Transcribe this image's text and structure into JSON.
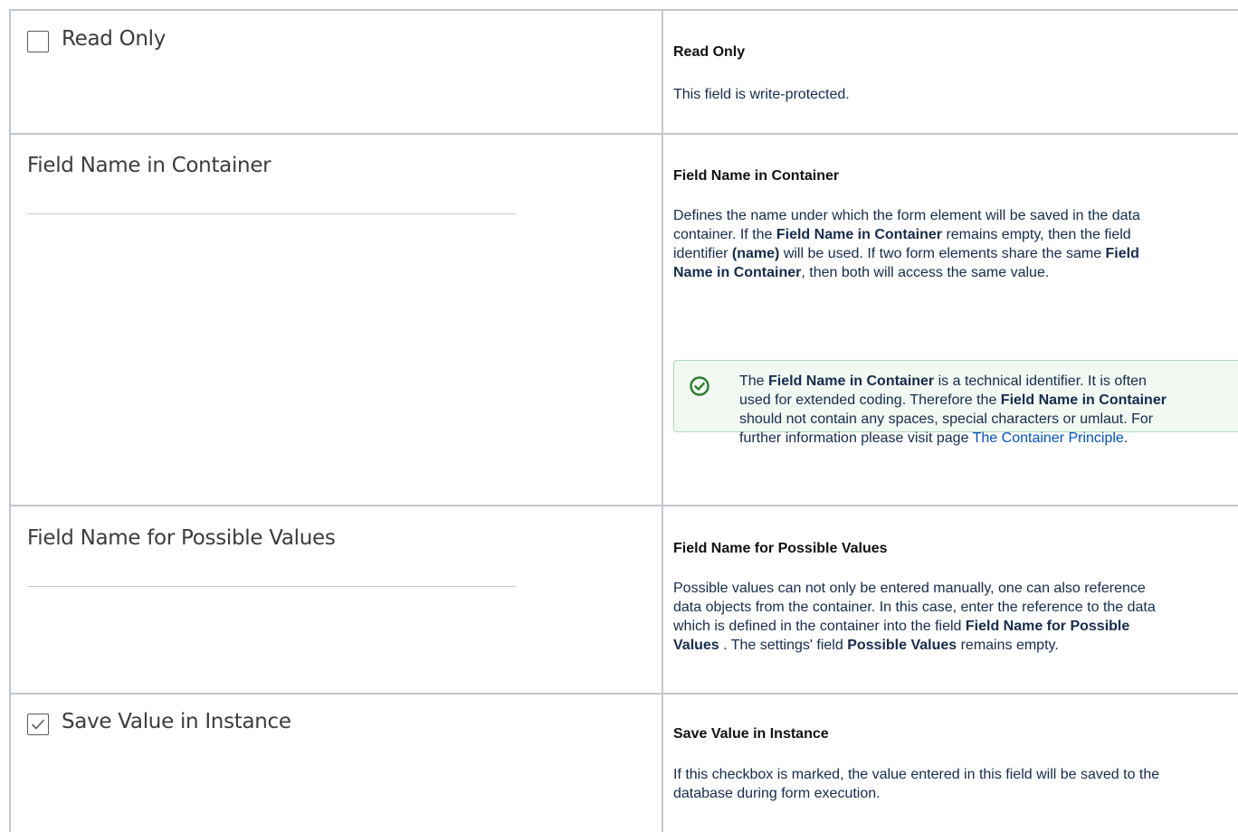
{
  "rows": [
    {
      "left_label": "Read Only",
      "left_checked": false,
      "heading": "Read Only",
      "text": "This field is write-protected."
    },
    {
      "left_label": "Field Name in Container",
      "heading": "Field Name in Container",
      "para": {
        "t1": "Defines the name under which the form element will be saved in the data",
        "t2": "container. If the ",
        "b1": "Field Name in Container",
        "t3": " remains empty, then the field",
        "t4": "identifier ",
        "b2": "(name)",
        "t5": " will be used. If two form elements share the same ",
        "b3": "Field",
        "b4": "Name in Container",
        "t6": ", then both will access the same value."
      },
      "note": {
        "icon": "check-circle-icon",
        "t1": "The ",
        "b1": "Field Name in Container",
        "t2": " is a technical identifier. It is often",
        "t3": "used for extended coding. Therefore the ",
        "b2": "Field Name in Container",
        "t4": "should not contain any spaces, special characters or umlaut. For",
        "t5": "further information please visit page ",
        "link": "The Container Principle",
        "t6": "."
      }
    },
    {
      "left_label": "Field Name for Possible Values",
      "heading": "Field Name for Possible Values",
      "para": {
        "t1": "Possible values can not only be entered manually, one can also reference",
        "t2": "data objects from the container. In this case, enter the reference to the data",
        "t3": "which is defined in the container into the field ",
        "b1": "Field Name for Possible",
        "b2": "Values",
        "t4": " . The settings' field ",
        "b3": "Possible Values",
        "t5": " remains empty."
      }
    },
    {
      "left_label": "Save Value in Instance",
      "left_checked": true,
      "heading": "Save Value in Instance",
      "para": {
        "t1": "If this checkbox is marked, the value entered in this field will be saved to the",
        "t2": "database during form execution."
      }
    }
  ],
  "colors": {
    "border": "#c1c7d0",
    "note_border": "#b3d9b9",
    "note_bg": "#f2f9f3",
    "note_icon": "#2e7d32",
    "link": "#0052cc"
  }
}
